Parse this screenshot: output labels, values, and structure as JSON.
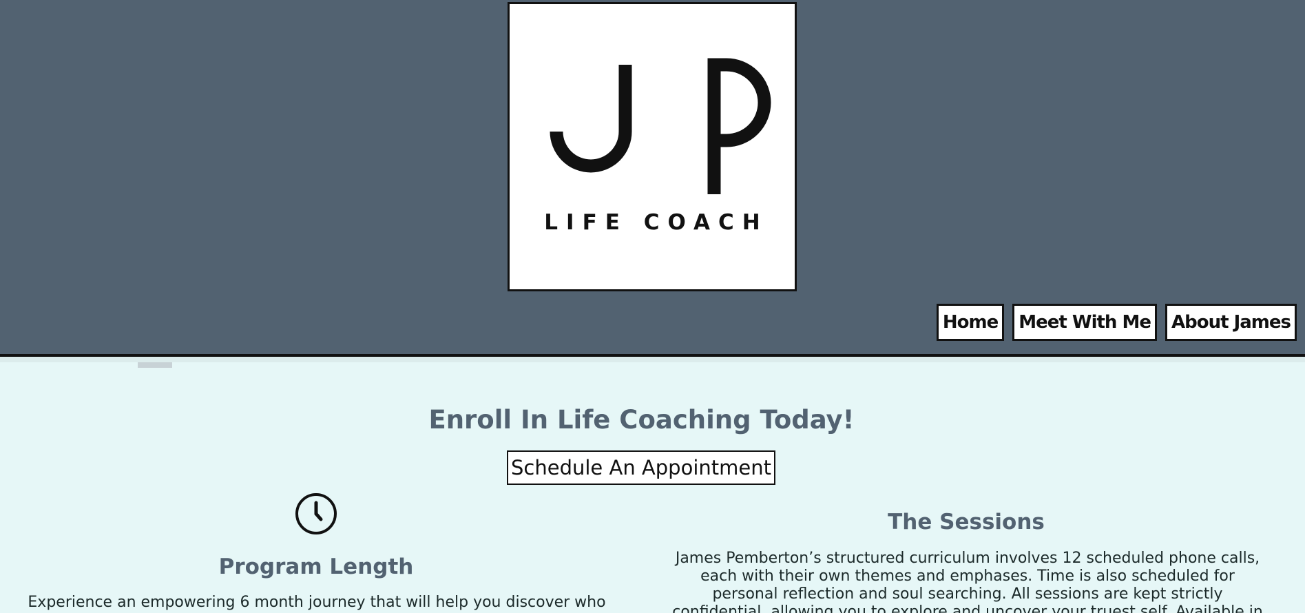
{
  "header": {
    "logo": {
      "monogram": "JP",
      "tagline": "LIFE COACH"
    },
    "nav": {
      "items": [
        {
          "label": "Home"
        },
        {
          "label": "Meet With Me"
        },
        {
          "label": "About James"
        }
      ]
    }
  },
  "main": {
    "headline": "Enroll In Life Coaching Today!",
    "cta_label": "Schedule An Appointment",
    "program": {
      "icon": "clock-icon",
      "title": "Program Length",
      "text": "Experience an empowering 6 month journey that will help you discover who"
    },
    "sessions": {
      "title": "The Sessions",
      "text": "James Pemberton’s structured curriculum involves 12 scheduled phone calls, each with their own themes and emphases. Time is also scheduled for personal reflection and soul searching. All sessions are kept strictly confidential, allowing you to explore and uncover your truest self. Available in both English"
    }
  },
  "colors": {
    "header_bg": "#526271",
    "page_bg": "#e6f7f7",
    "heading": "#526271",
    "border": "#111111"
  }
}
